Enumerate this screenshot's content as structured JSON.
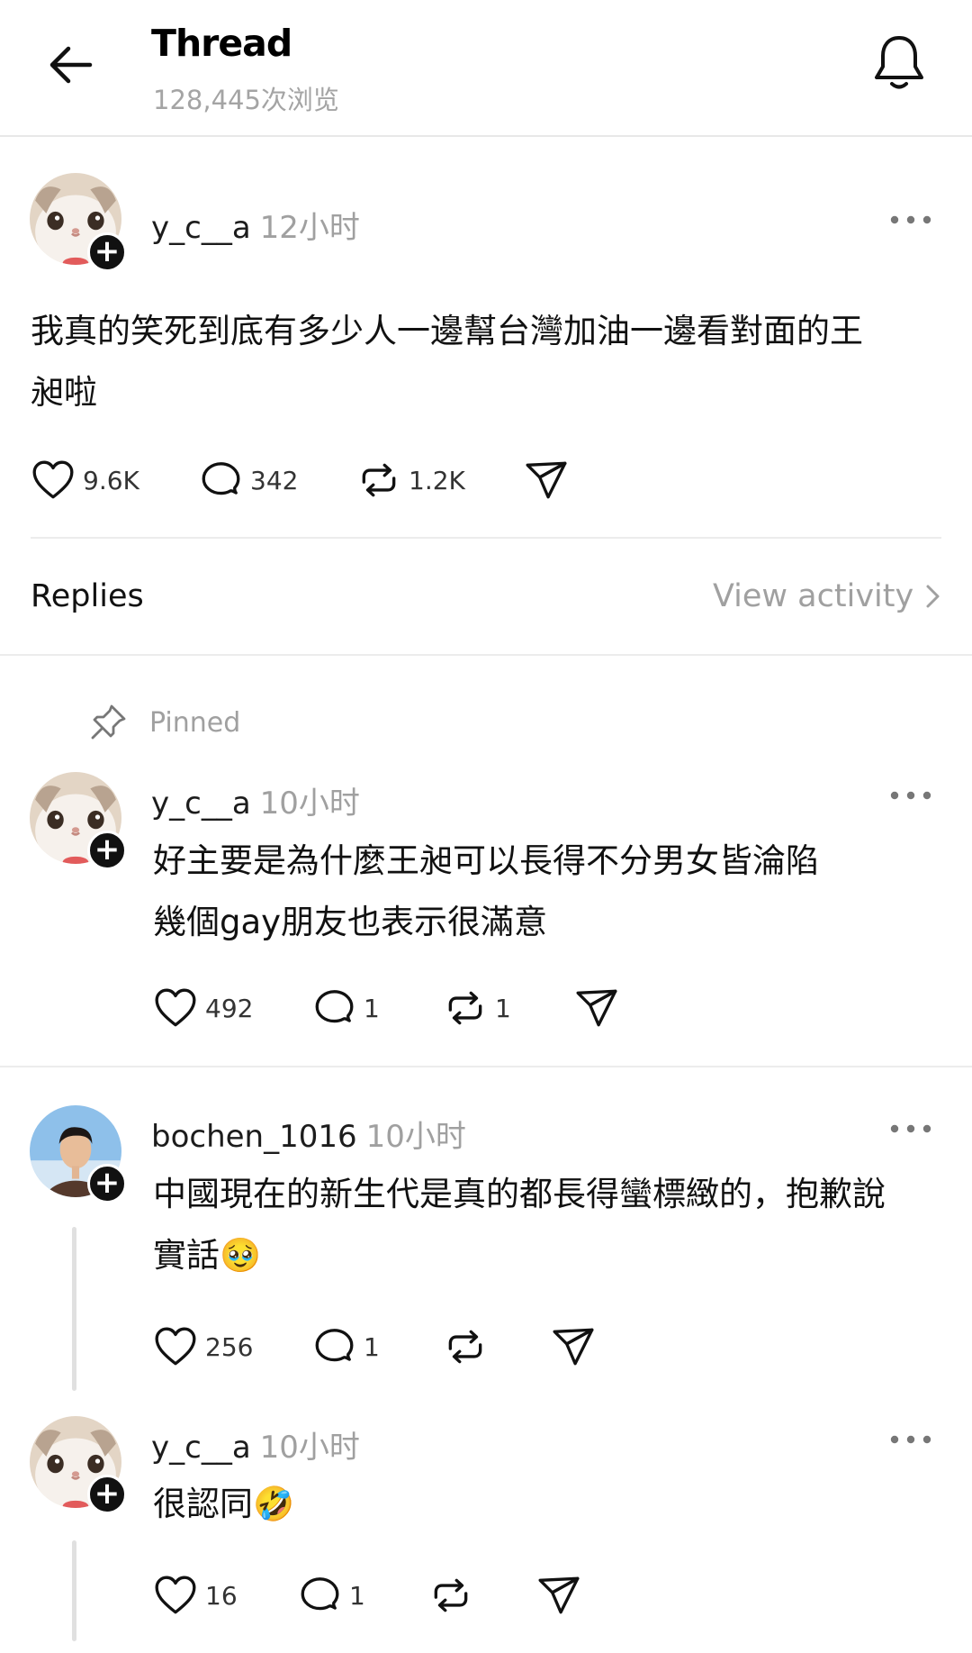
{
  "header": {
    "title": "Thread",
    "views": "128,445次浏览"
  },
  "post": {
    "username": "y_c__a",
    "time": "12小时",
    "text_line1": "我真的笑死到底有多少人一邊幫台灣加油一邊看對面的王",
    "text_line2": "昶啦",
    "likes": "9.6K",
    "comments": "342",
    "reposts": "1.2K"
  },
  "replies_bar": {
    "label": "Replies",
    "view_activity": "View activity"
  },
  "pinned": {
    "label": "Pinned"
  },
  "replies": [
    {
      "username": "y_c__a",
      "time": "10小时",
      "line1": "好主要是為什麼王昶可以長得不分男女皆淪陷",
      "line2": "幾個gay朋友也表示很滿意",
      "likes": "492",
      "comments": "1",
      "reposts": "1"
    },
    {
      "username": "bochen_1016",
      "time": "10小时",
      "line1": "中國現在的新生代是真的都長得蠻標緻的，抱歉說",
      "line2": "實話",
      "emoji": "🥹",
      "likes": "256",
      "comments": "1",
      "reposts": ""
    },
    {
      "username": "y_c__a",
      "time": "10小时",
      "line1": "很認同",
      "emoji": "🤣",
      "likes": "16",
      "comments": "1",
      "reposts": ""
    }
  ]
}
